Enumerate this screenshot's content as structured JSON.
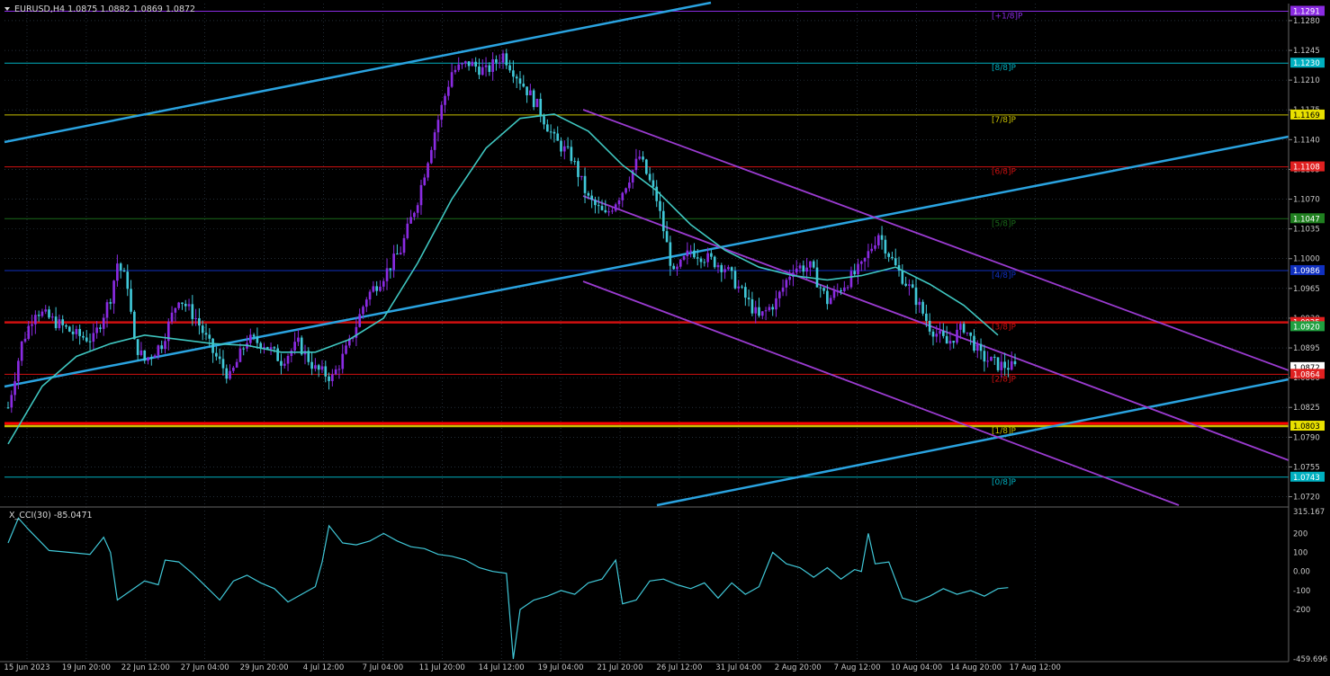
{
  "header": {
    "symbol_info": "EURUSD,H4  1.0875 1.0882 1.0869 1.0872"
  },
  "indicator": {
    "label": "X_CCI(30) -85.0471",
    "ticks": [
      "315.167",
      "200",
      "100",
      "0.00",
      "-100",
      "-200",
      "-459.696"
    ]
  },
  "colors": {
    "background": "#000000",
    "grid": "#3a4a5a",
    "bull_candle": "#8a2be2",
    "bear_candle": "#40c8d8",
    "ma_line": "#3fc6c0",
    "channel_blue": "#2aa3e0",
    "channel_purple": "#9a3bd0",
    "support_red": "#ff0000",
    "cci_line": "#40c8d8"
  },
  "price_axis": {
    "ticks": [
      "1.1280",
      "1.1245",
      "1.1210",
      "1.1175",
      "1.1140",
      "1.1105",
      "1.1070",
      "1.1035",
      "1.1000",
      "1.0965",
      "1.0930",
      "1.0895",
      "1.0860",
      "1.0825",
      "1.0790",
      "1.0755",
      "1.0720"
    ],
    "price_labels": [
      {
        "price": 1.1291,
        "text": "1.1291",
        "color": "#8a2be2"
      },
      {
        "price": 1.123,
        "text": "1.1230",
        "color": "#00b0c0"
      },
      {
        "price": 1.1169,
        "text": "1.1169",
        "color": "#e8e000"
      },
      {
        "price": 1.1108,
        "text": "1.1108",
        "color": "#e02020"
      },
      {
        "price": 1.1047,
        "text": "1.1047",
        "color": "#208020"
      },
      {
        "price": 1.0986,
        "text": "1.0986",
        "color": "#1030c0"
      },
      {
        "price": 1.0925,
        "text": "1.0925",
        "color": "#e02020"
      },
      {
        "price": 1.092,
        "text": "1.0920",
        "color": "#20a040"
      },
      {
        "price": 1.0872,
        "text": "1.0872",
        "color": "#ffffff"
      },
      {
        "price": 1.0864,
        "text": "1.0864",
        "color": "#e02020"
      },
      {
        "price": 1.0803,
        "text": "1.0803",
        "color": "#e8e000"
      },
      {
        "price": 1.0743,
        "text": "1.0743",
        "color": "#00b0c0"
      }
    ]
  },
  "murrey_levels": [
    {
      "price": 1.1291,
      "label": "[+1/8]P",
      "color": "#8a2be2"
    },
    {
      "price": 1.123,
      "label": "[8/8]P",
      "color": "#00b0c0"
    },
    {
      "price": 1.1169,
      "label": "[7/8]P",
      "color": "#c8c000"
    },
    {
      "price": 1.1108,
      "label": "[6/8]P",
      "color": "#d01010"
    },
    {
      "price": 1.1047,
      "label": "[5/8]P",
      "color": "#1a6a1a"
    },
    {
      "price": 1.0986,
      "label": "[4/8]P",
      "color": "#1030c0"
    },
    {
      "price": 1.0925,
      "label": "[3/8]P",
      "color": "#d01010"
    },
    {
      "price": 1.0864,
      "label": "[2/8]P",
      "color": "#d01010"
    },
    {
      "price": 1.0803,
      "label": "[1/8]P",
      "color": "#c8c000"
    },
    {
      "price": 1.0743,
      "label": "[0/8]P",
      "color": "#00b0c0"
    }
  ],
  "time_axis": {
    "labels": [
      "15 Jun 2023",
      "19 Jun 20:00",
      "22 Jun 12:00",
      "27 Jun 04:00",
      "29 Jun 20:00",
      "4 Jul 12:00",
      "7 Jul 04:00",
      "11 Jul 20:00",
      "14 Jul 12:00",
      "19 Jul 04:00",
      "21 Jul 20:00",
      "26 Jul 12:00",
      "31 Jul 04:00",
      "2 Aug 20:00",
      "7 Aug 12:00",
      "10 Aug 04:00",
      "14 Aug 20:00",
      "17 Aug 12:00"
    ]
  },
  "chart_data": {
    "type": "candlestick",
    "price_range": [
      1.071,
      1.13
    ],
    "cci_range": [
      -459.696,
      315.167
    ],
    "close_path": [
      [
        0,
        1.0825
      ],
      [
        4,
        1.09
      ],
      [
        8,
        1.094
      ],
      [
        12,
        1.093
      ],
      [
        16,
        1.092
      ],
      [
        20,
        1.091
      ],
      [
        25,
        1.0905
      ],
      [
        30,
        1.0955
      ],
      [
        32,
        1.0995
      ],
      [
        35,
        1.097
      ],
      [
        37,
        1.09
      ],
      [
        40,
        1.088
      ],
      [
        45,
        1.09
      ],
      [
        50,
        1.0955
      ],
      [
        55,
        1.093
      ],
      [
        60,
        1.089
      ],
      [
        65,
        1.086
      ],
      [
        70,
        1.0905
      ],
      [
        75,
        1.09
      ],
      [
        80,
        1.088
      ],
      [
        85,
        1.09
      ],
      [
        90,
        1.087
      ],
      [
        95,
        1.086
      ],
      [
        100,
        1.09
      ],
      [
        105,
        1.0955
      ],
      [
        110,
        1.098
      ],
      [
        115,
        1.101
      ],
      [
        120,
        1.107
      ],
      [
        125,
        1.115
      ],
      [
        130,
        1.122
      ],
      [
        135,
        1.123
      ],
      [
        140,
        1.122
      ],
      [
        145,
        1.124
      ],
      [
        150,
        1.121
      ],
      [
        155,
        1.118
      ],
      [
        160,
        1.114
      ],
      [
        165,
        1.112
      ],
      [
        170,
        1.107
      ],
      [
        175,
        1.105
      ],
      [
        180,
        1.108
      ],
      [
        185,
        1.112
      ],
      [
        190,
        1.107
      ],
      [
        195,
        1.098
      ],
      [
        200,
        1.101
      ],
      [
        205,
        1.1
      ],
      [
        210,
        1.099
      ],
      [
        215,
        1.096
      ],
      [
        220,
        1.093
      ],
      [
        225,
        1.095
      ],
      [
        230,
        1.099
      ],
      [
        235,
        1.099
      ],
      [
        240,
        1.095
      ],
      [
        245,
        1.097
      ],
      [
        250,
        1.099
      ],
      [
        255,
        1.103
      ],
      [
        260,
        1.099
      ],
      [
        265,
        1.096
      ],
      [
        270,
        1.092
      ],
      [
        275,
        1.09
      ],
      [
        280,
        1.092
      ],
      [
        285,
        1.0885
      ],
      [
        290,
        1.0875
      ],
      [
        295,
        1.0872
      ]
    ],
    "ma_path": [
      [
        0,
        1.0782
      ],
      [
        10,
        1.085
      ],
      [
        20,
        1.0885
      ],
      [
        30,
        1.09
      ],
      [
        40,
        1.091
      ],
      [
        50,
        1.0905
      ],
      [
        60,
        1.09
      ],
      [
        70,
        1.0898
      ],
      [
        80,
        1.089
      ],
      [
        90,
        1.089
      ],
      [
        100,
        1.0905
      ],
      [
        110,
        1.093
      ],
      [
        120,
        1.0995
      ],
      [
        130,
        1.107
      ],
      [
        140,
        1.113
      ],
      [
        150,
        1.1165
      ],
      [
        160,
        1.117
      ],
      [
        170,
        1.115
      ],
      [
        180,
        1.111
      ],
      [
        190,
        1.108
      ],
      [
        200,
        1.104
      ],
      [
        210,
        1.101
      ],
      [
        220,
        1.099
      ],
      [
        230,
        1.098
      ],
      [
        240,
        1.0975
      ],
      [
        250,
        1.098
      ],
      [
        260,
        1.099
      ],
      [
        270,
        1.097
      ],
      [
        280,
        1.0945
      ],
      [
        290,
        1.091
      ]
    ],
    "cci_path": [
      [
        0,
        150
      ],
      [
        3,
        280
      ],
      [
        6,
        220
      ],
      [
        12,
        110
      ],
      [
        18,
        100
      ],
      [
        24,
        90
      ],
      [
        28,
        180
      ],
      [
        30,
        100
      ],
      [
        32,
        -150
      ],
      [
        36,
        -100
      ],
      [
        40,
        -50
      ],
      [
        44,
        -70
      ],
      [
        46,
        60
      ],
      [
        50,
        50
      ],
      [
        54,
        -10
      ],
      [
        58,
        -80
      ],
      [
        62,
        -150
      ],
      [
        66,
        -50
      ],
      [
        70,
        -20
      ],
      [
        74,
        -60
      ],
      [
        78,
        -90
      ],
      [
        82,
        -160
      ],
      [
        86,
        -120
      ],
      [
        90,
        -80
      ],
      [
        92,
        50
      ],
      [
        94,
        240
      ],
      [
        98,
        150
      ],
      [
        102,
        140
      ],
      [
        106,
        160
      ],
      [
        110,
        200
      ],
      [
        114,
        160
      ],
      [
        118,
        130
      ],
      [
        122,
        120
      ],
      [
        126,
        90
      ],
      [
        130,
        80
      ],
      [
        134,
        60
      ],
      [
        138,
        20
      ],
      [
        142,
        0
      ],
      [
        146,
        -10
      ],
      [
        148,
        -460
      ],
      [
        150,
        -200
      ],
      [
        154,
        -150
      ],
      [
        158,
        -130
      ],
      [
        162,
        -100
      ],
      [
        166,
        -120
      ],
      [
        170,
        -60
      ],
      [
        174,
        -40
      ],
      [
        178,
        60
      ],
      [
        180,
        -170
      ],
      [
        184,
        -150
      ],
      [
        188,
        -50
      ],
      [
        192,
        -40
      ],
      [
        196,
        -70
      ],
      [
        200,
        -90
      ],
      [
        204,
        -60
      ],
      [
        208,
        -140
      ],
      [
        212,
        -60
      ],
      [
        216,
        -120
      ],
      [
        220,
        -80
      ],
      [
        224,
        100
      ],
      [
        228,
        40
      ],
      [
        232,
        20
      ],
      [
        236,
        -30
      ],
      [
        240,
        20
      ],
      [
        244,
        -40
      ],
      [
        248,
        10
      ],
      [
        250,
        0
      ],
      [
        252,
        200
      ],
      [
        254,
        40
      ],
      [
        258,
        50
      ],
      [
        262,
        -140
      ],
      [
        266,
        -160
      ],
      [
        270,
        -130
      ],
      [
        274,
        -90
      ],
      [
        278,
        -120
      ],
      [
        282,
        -100
      ],
      [
        286,
        -130
      ],
      [
        290,
        -90
      ],
      [
        293,
        -85
      ]
    ],
    "bars_count": 296
  }
}
